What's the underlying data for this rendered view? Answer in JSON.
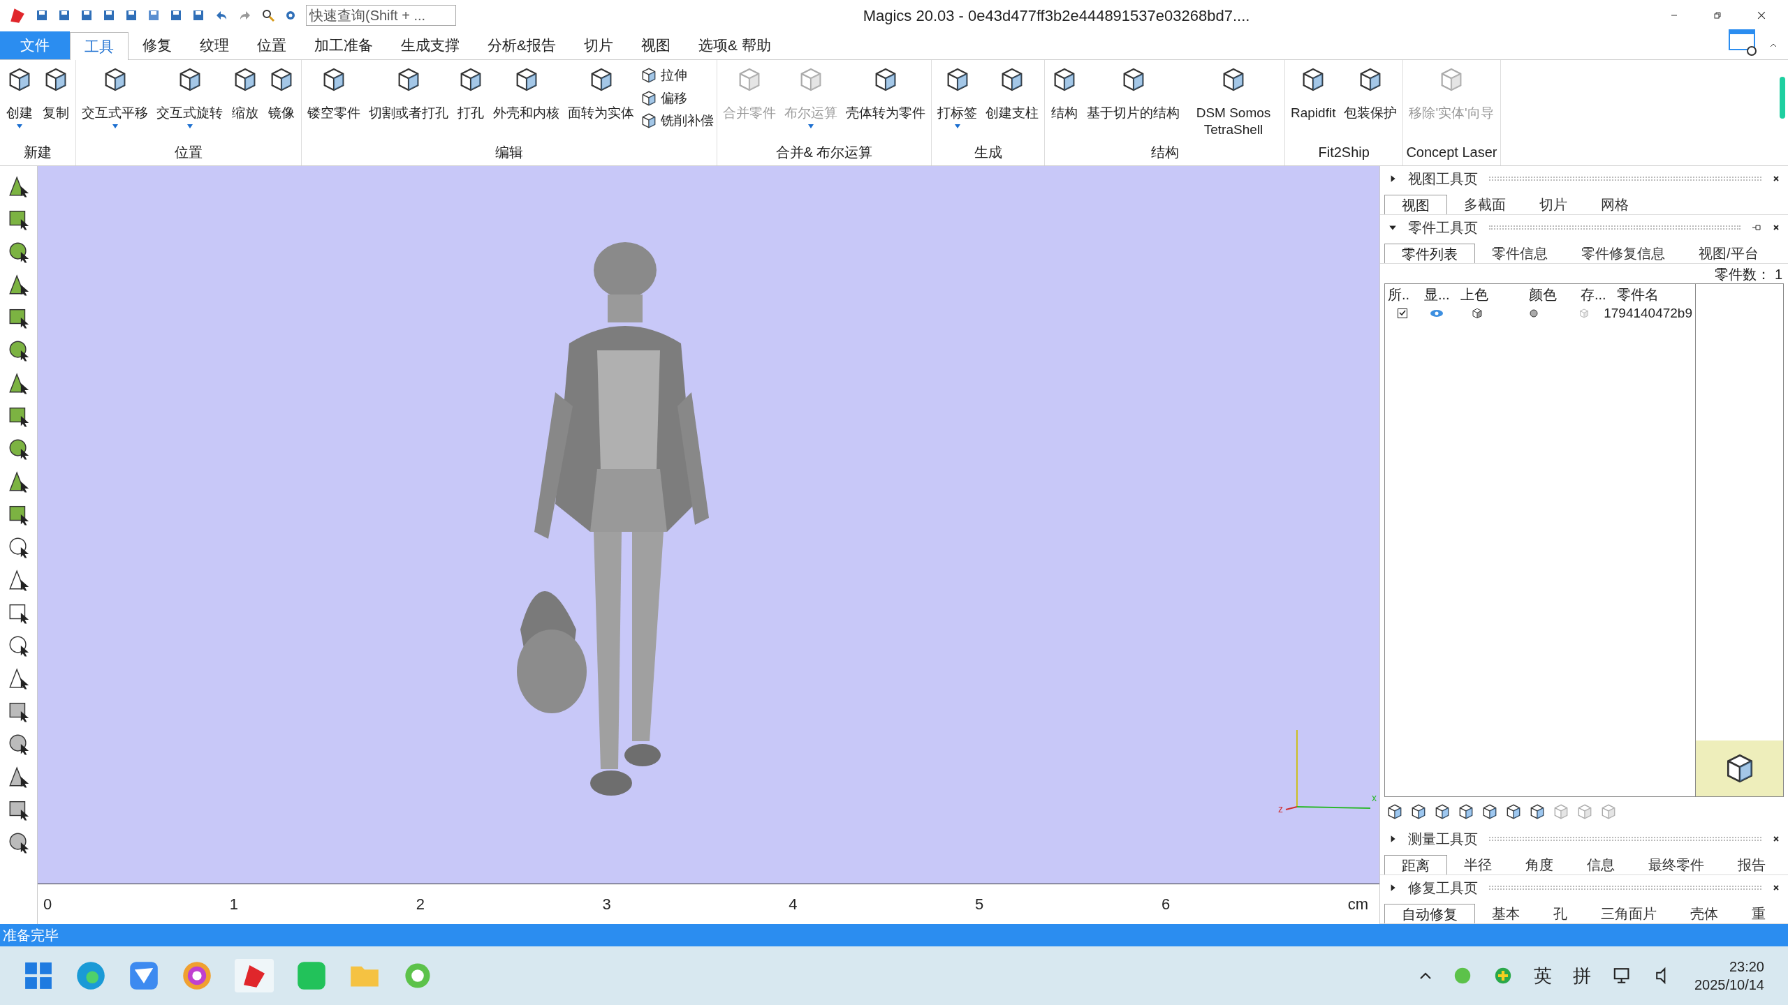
{
  "window": {
    "title": "Magics 20.03 - 0e43d477ff3b2e444891537e03268bd7....",
    "quick_search": {
      "placeholder": "快速查询(Shift + ..."
    }
  },
  "menu": [
    {
      "label": "文件",
      "kind": "file",
      "selected": false
    },
    {
      "label": "工具",
      "kind": "tab",
      "selected": true
    },
    {
      "label": "修复",
      "kind": "tab",
      "selected": false
    },
    {
      "label": "纹理",
      "kind": "tab",
      "selected": false
    },
    {
      "label": "位置",
      "kind": "tab",
      "selected": false
    },
    {
      "label": "加工准备",
      "kind": "tab",
      "selected": false
    },
    {
      "label": "生成支撑",
      "kind": "tab",
      "selected": false
    },
    {
      "label": "分析&报告",
      "kind": "tab",
      "selected": false
    },
    {
      "label": "切片",
      "kind": "tab",
      "selected": false
    },
    {
      "label": "视图",
      "kind": "tab",
      "selected": false
    },
    {
      "label": "选项& 帮助",
      "kind": "tab",
      "selected": false
    }
  ],
  "ribbon": [
    {
      "label": "新建",
      "tools": [
        {
          "label": "创建",
          "kind": "large",
          "disabled": false,
          "dropdown": true
        },
        {
          "label": "复制",
          "kind": "large",
          "disabled": false,
          "dropdown": false
        }
      ]
    },
    {
      "label": "位置",
      "tools": [
        {
          "label": "交互式平移",
          "kind": "large",
          "disabled": false,
          "dropdown": true
        },
        {
          "label": "交互式旋转",
          "kind": "large",
          "disabled": false,
          "dropdown": true
        },
        {
          "label": "缩放",
          "kind": "large",
          "disabled": false,
          "dropdown": false
        },
        {
          "label": "镜像",
          "kind": "large",
          "disabled": false,
          "dropdown": false
        }
      ]
    },
    {
      "label": "编辑",
      "tools": [
        {
          "label": "镂空零件",
          "kind": "large",
          "disabled": false,
          "dropdown": false
        },
        {
          "label": "切割或者打孔",
          "kind": "large",
          "disabled": false,
          "dropdown": false
        },
        {
          "label": "打孔",
          "kind": "large",
          "disabled": false,
          "dropdown": false
        },
        {
          "label": "外壳和内核",
          "kind": "large",
          "disabled": false,
          "dropdown": false
        },
        {
          "label": "面转为实体",
          "kind": "large",
          "disabled": false,
          "dropdown": false
        },
        {
          "label": "拉伸",
          "kind": "small",
          "disabled": false
        },
        {
          "label": "偏移",
          "kind": "small",
          "disabled": false
        },
        {
          "label": "铣削补偿",
          "kind": "small",
          "disabled": false
        }
      ]
    },
    {
      "label": "合并& 布尔运算",
      "tools": [
        {
          "label": "合并零件",
          "kind": "large",
          "disabled": true,
          "dropdown": false
        },
        {
          "label": "布尔运算",
          "kind": "large",
          "disabled": true,
          "dropdown": true
        },
        {
          "label": "壳体转为零件",
          "kind": "large",
          "disabled": false,
          "dropdown": false
        }
      ]
    },
    {
      "label": "生成",
      "tools": [
        {
          "label": "打标签",
          "kind": "large",
          "disabled": false,
          "dropdown": true
        },
        {
          "label": "创建支柱",
          "kind": "large",
          "disabled": false,
          "dropdown": false
        }
      ]
    },
    {
      "label": "结构",
      "tools": [
        {
          "label": "结构",
          "kind": "large",
          "disabled": false,
          "dropdown": false
        },
        {
          "label": "基于切片的结构",
          "kind": "large",
          "disabled": false,
          "dropdown": false
        },
        {
          "label": "DSM Somos TetraShell",
          "kind": "large",
          "disabled": false,
          "dropdown": false
        }
      ]
    },
    {
      "label": "Fit2Ship",
      "tools": [
        {
          "label": "Rapidfit",
          "kind": "large",
          "disabled": false,
          "dropdown": false
        },
        {
          "label": "包装保护",
          "kind": "large",
          "disabled": false,
          "dropdown": false
        }
      ]
    },
    {
      "label": "Concept Laser",
      "tools": [
        {
          "label": "移除'实体'向导",
          "kind": "large",
          "disabled": true,
          "dropdown": false
        }
      ]
    }
  ],
  "viewport": {
    "kind": "picture",
    "axes": [
      "z",
      "x"
    ],
    "ruler": {
      "ticks": [
        "0",
        "1",
        "2",
        "3",
        "4",
        "5",
        "6"
      ],
      "unit": "cm"
    }
  },
  "panels": [
    {
      "title": "视图工具页",
      "expanded": false,
      "tabs": [
        {
          "label": "视图",
          "selected": true
        },
        {
          "label": "多截面",
          "selected": false
        },
        {
          "label": "切片",
          "selected": false
        },
        {
          "label": "网格",
          "selected": false
        }
      ]
    },
    {
      "title": "零件工具页",
      "expanded": true,
      "tabs": [
        {
          "label": "零件列表",
          "selected": true
        },
        {
          "label": "零件信息",
          "selected": false
        },
        {
          "label": "零件修复信息",
          "selected": false
        },
        {
          "label": "视图/平台",
          "selected": false
        }
      ],
      "count_label": "零件数：",
      "count": "1",
      "columns": [
        "所..",
        "显...",
        "上色",
        "颜色",
        "存...",
        "零件名"
      ],
      "rows": [
        {
          "checked": true,
          "visible": true,
          "name": "1794140472b9"
        }
      ]
    },
    {
      "title": "测量工具页",
      "expanded": false,
      "tabs": [
        {
          "label": "距离",
          "selected": true
        },
        {
          "label": "半径",
          "selected": false
        },
        {
          "label": "角度",
          "selected": false
        },
        {
          "label": "信息",
          "selected": false
        },
        {
          "label": "最终零件",
          "selected": false
        },
        {
          "label": "报告",
          "selected": false
        }
      ]
    },
    {
      "title": "修复工具页",
      "expanded": false,
      "tabs": [
        {
          "label": "自动修复",
          "selected": true
        },
        {
          "label": "基本",
          "selected": false
        },
        {
          "label": "孔",
          "selected": false
        },
        {
          "label": "三角面片",
          "selected": false
        },
        {
          "label": "壳体",
          "selected": false
        },
        {
          "label": "重",
          "selected": false
        }
      ]
    }
  ],
  "status_bar": "准备完毕",
  "taskbar": {
    "tray": [
      "英",
      "拼"
    ],
    "time": "23:20",
    "date": "2025/10/14"
  }
}
